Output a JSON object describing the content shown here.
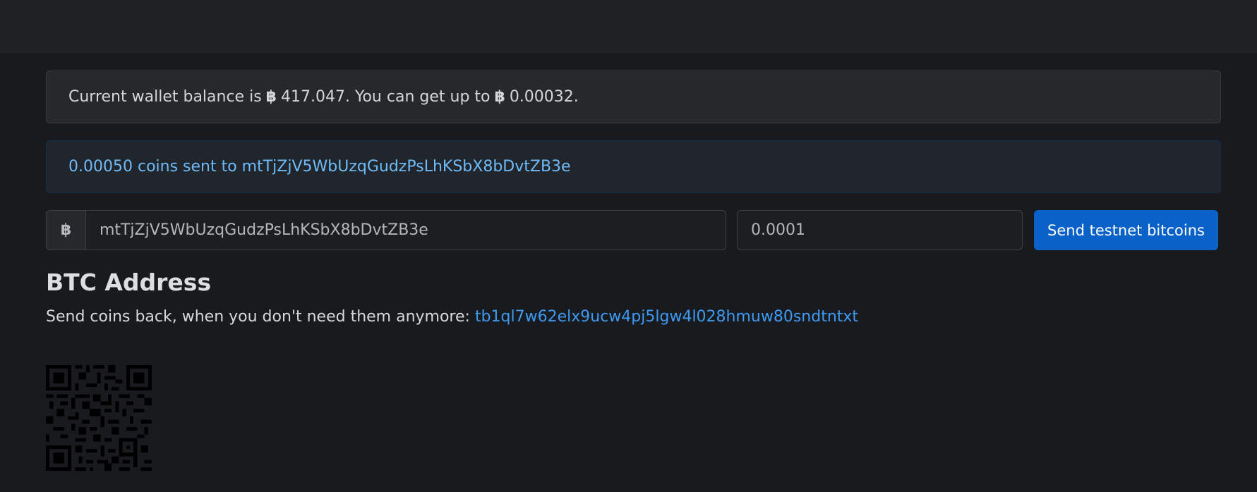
{
  "balance_alert": {
    "prefix": "Current wallet balance is",
    "currency_symbol": "฿",
    "balance": "417.047",
    "middle": ". You can get up to",
    "max_amount": "0.00032",
    "suffix": "."
  },
  "sent_alert": {
    "text": "0.00050 coins sent to mtTjZjV5WbUzqGudzPsLhKSbX8bDvtZB3e"
  },
  "form": {
    "addon_symbol": "฿",
    "address_value": "mtTjZjV5WbUzqGudzPsLhKSbX8bDvtZB3e",
    "amount_value": "0.0001",
    "send_label": "Send testnet bitcoins"
  },
  "btc_section": {
    "heading": "BTC Address",
    "return_text": "Send coins back, when you don't need them anymore:",
    "return_address": "tb1ql7w62elx9ucw4pj5lgw4l028hmuw80sndtntxt",
    "qr_icon": "qr-code-icon"
  },
  "colors": {
    "background": "#181a1d",
    "navbar": "#1f2225",
    "info_text": "#6fbaf8",
    "link": "#3d9af5",
    "primary_button": "#0a62c9"
  }
}
